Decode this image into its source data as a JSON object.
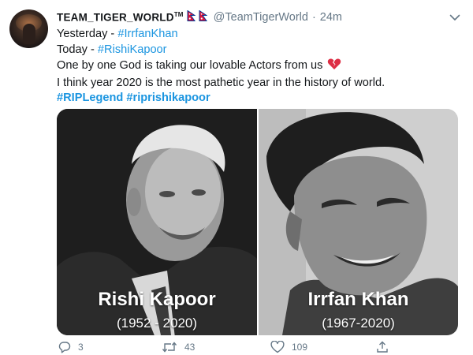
{
  "tweet": {
    "author": {
      "display_name": "TEAM_TIGER_WORLD",
      "tm_mark": "TM",
      "handle": "@TeamTigerWorld",
      "time_separator": "·",
      "timestamp": "24m",
      "flag_icons": [
        "nepal-flag-icon",
        "nepal-flag-icon"
      ]
    },
    "text": {
      "line1_prefix": "Yesterday - ",
      "line1_link": "#IrrfanKhan",
      "line2_prefix": "Today - ",
      "line2_link": "#RishiKapoor",
      "line3": "One by one God is taking our lovable Actors from us",
      "line3_emoji": "broken-heart-icon",
      "line4": "I think  year 2020 is the most pathetic year in the history of world.",
      "hashtag1": "#RIPLegend",
      "hashtag2": "#riprishikapoor"
    },
    "media": {
      "left": {
        "name": "Rishi Kapoor",
        "years": "(1952 - 2020)"
      },
      "right": {
        "name": "Irrfan Khan",
        "years": "(1967-2020)"
      }
    },
    "actions": {
      "reply_count": "3",
      "retweet_count": "43",
      "like_count": "109"
    },
    "colors": {
      "link": "#1b95e0",
      "secondary_text": "#657786",
      "primary_text": "#14171a"
    }
  }
}
